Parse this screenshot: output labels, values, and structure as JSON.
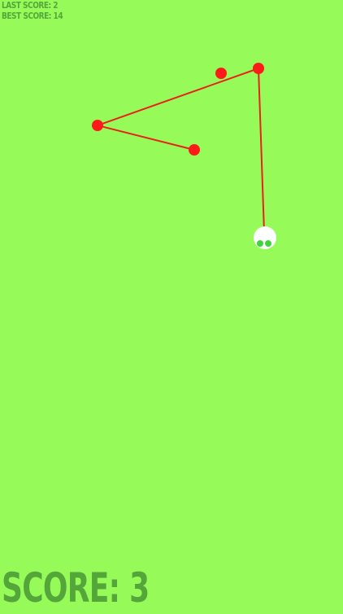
{
  "hud": {
    "last_score": "LAST SCORE: 2",
    "best_score": "BEST SCORE: 14",
    "score": "SCORE: 3"
  },
  "colors": {
    "background": "#96fb58",
    "hud_text": "#55a63a",
    "rope": "#e8231a",
    "node": "#ff1a1a",
    "ball": "#ffffff",
    "ball_eyes": "#3fd43c"
  },
  "icons": {
    "rope_node": "red-dot",
    "target": "red-dot",
    "player": "white-ball-with-green-eyes"
  }
}
